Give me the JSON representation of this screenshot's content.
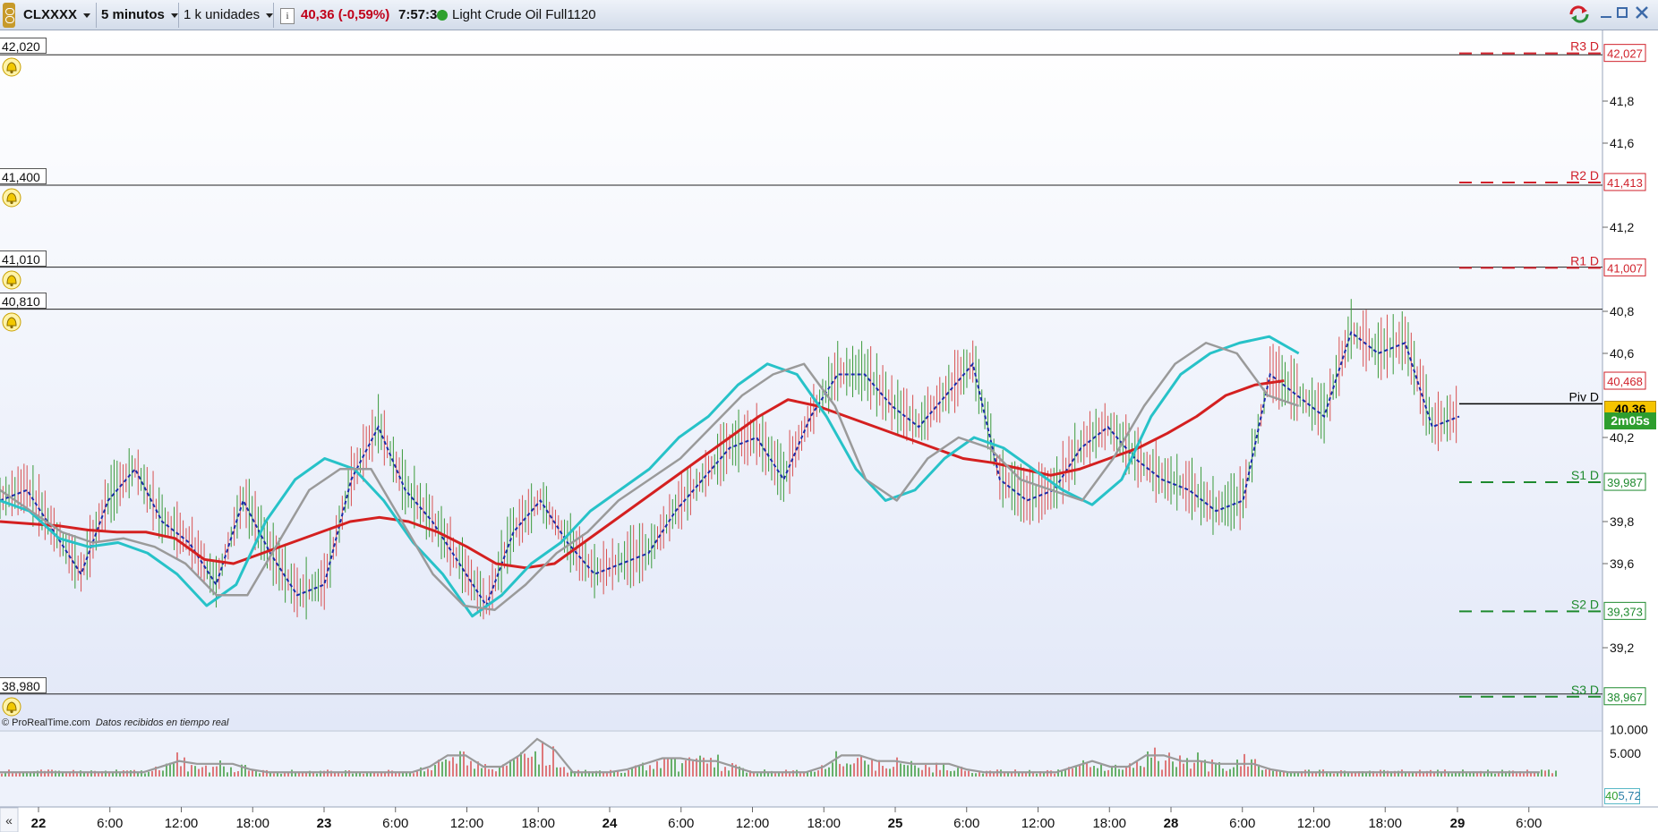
{
  "toolbar": {
    "symbol": "CLXXXX",
    "timeframe": "5 minutos",
    "units": "1 k unidades",
    "price_change": "40,36 (-0,59%)",
    "time": "7:57:34",
    "instrument": "Light Crude Oil Full1120",
    "colors": {
      "change": "#c0001a",
      "status_dot": "#2ea12e"
    }
  },
  "window_controls": [
    "refresh-icon",
    "minimize-icon",
    "maximize-icon",
    "close-icon"
  ],
  "horizontal_lines": [
    {
      "price": 42.02,
      "label": "42,020"
    },
    {
      "price": 41.4,
      "label": "41,400"
    },
    {
      "price": 41.01,
      "label": "41,010"
    },
    {
      "price": 40.81,
      "label": "40,810"
    },
    {
      "price": 38.98,
      "label": "38,980"
    }
  ],
  "pivots": [
    {
      "name": "R3 D",
      "value": 42.027,
      "label": "42,027",
      "color": "#d0202a"
    },
    {
      "name": "R2 D",
      "value": 41.413,
      "label": "41,413",
      "color": "#d0202a"
    },
    {
      "name": "R1 D",
      "value": 41.007,
      "label": "41,007",
      "color": "#d0202a"
    },
    {
      "name": "Piv D",
      "value": 40.36,
      "label": "",
      "color": "#000000"
    },
    {
      "name": "S1 D",
      "value": 39.987,
      "label": "39,987",
      "color": "#1e8a2e"
    },
    {
      "name": "S2 D",
      "value": 39.373,
      "label": "39,373",
      "color": "#1e8a2e"
    },
    {
      "name": "S3 D",
      "value": 38.967,
      "label": "38,967",
      "color": "#1e8a2e"
    }
  ],
  "price_axis": {
    "ticks": [
      {
        "v": 41.8,
        "l": "41,8"
      },
      {
        "v": 41.6,
        "l": "41,6"
      },
      {
        "v": 41.2,
        "l": "41,2"
      },
      {
        "v": 40.8,
        "l": "40,8"
      },
      {
        "v": 40.6,
        "l": "40,6"
      },
      {
        "v": 40.2,
        "l": "40,2"
      },
      {
        "v": 39.8,
        "l": "39,8"
      },
      {
        "v": 39.6,
        "l": "39,6"
      },
      {
        "v": 39.2,
        "l": "39,2"
      }
    ],
    "ma_value": {
      "v": 40.468,
      "l": "40,468"
    },
    "last_price": {
      "v": 40.36,
      "l": "40,36"
    },
    "countdown": "2m05s"
  },
  "volume_axis": {
    "ticks": [
      {
        "v": 10000,
        "l": "10.000"
      },
      {
        "v": 5000,
        "l": "5.000"
      }
    ],
    "current": "40",
    "current_suffix": "5,72"
  },
  "footer_note": {
    "site": "© ProRealTime.com",
    "status": "Datos recibidos en tiempo real"
  },
  "time_axis": [
    {
      "l": "22",
      "bold": true
    },
    {
      "l": "6:00"
    },
    {
      "l": "12:00"
    },
    {
      "l": "18:00"
    },
    {
      "l": "23",
      "bold": true
    },
    {
      "l": "6:00"
    },
    {
      "l": "12:00"
    },
    {
      "l": "18:00"
    },
    {
      "l": "24",
      "bold": true
    },
    {
      "l": "6:00"
    },
    {
      "l": "12:00"
    },
    {
      "l": "18:00"
    },
    {
      "l": "25",
      "bold": true
    },
    {
      "l": "6:00"
    },
    {
      "l": "12:00"
    },
    {
      "l": "18:00"
    },
    {
      "l": "28",
      "bold": true
    },
    {
      "l": "6:00"
    },
    {
      "l": "12:00"
    },
    {
      "l": "18:00"
    },
    {
      "l": "29",
      "bold": true
    },
    {
      "l": "6:00"
    }
  ],
  "chart_data": {
    "type": "line",
    "x": [
      0,
      10,
      20,
      30,
      40,
      50,
      60,
      70,
      80,
      90,
      100,
      110,
      120,
      130,
      140,
      150,
      160,
      170,
      180,
      190,
      200,
      210,
      220,
      230,
      240,
      250,
      260,
      270,
      280,
      290,
      300,
      310,
      320,
      330,
      340,
      350,
      360,
      370,
      380,
      390,
      400,
      410,
      420,
      430,
      440,
      450,
      460,
      470,
      480,
      490,
      500,
      510,
      520,
      530,
      540
    ],
    "series": [
      {
        "name": "",
        "color": "#1a7f1a",
        "values": [
          39.9,
          39.95,
          39.75,
          39.55,
          39.9,
          40.05,
          39.8,
          39.7,
          39.5,
          39.9,
          39.65,
          39.45,
          39.5,
          40.0,
          40.25,
          39.95,
          39.8,
          39.6,
          39.4,
          39.75,
          39.9,
          39.7,
          39.55,
          39.6,
          39.65,
          39.85,
          40.0,
          40.15,
          40.2,
          40.0,
          40.3,
          40.5,
          40.5,
          40.35,
          40.25,
          40.4,
          40.55,
          40.0,
          39.9,
          39.95,
          40.15,
          40.25,
          40.1,
          40.0,
          39.95,
          39.85,
          39.9,
          40.5,
          40.4,
          40.3,
          40.7,
          40.6,
          40.65,
          40.25,
          40.3
        ]
      },
      {
        "name": "",
        "color": "#d42020",
        "values": [
          39.8,
          39.79,
          39.78,
          39.76,
          39.75,
          39.75,
          39.72,
          39.62,
          39.6,
          39.65,
          39.7,
          39.75,
          39.8,
          39.82,
          39.8,
          39.75,
          39.68,
          39.6,
          39.58,
          39.6,
          39.7,
          39.8,
          39.9,
          40.0,
          40.1,
          40.2,
          40.3,
          40.38,
          40.35,
          40.3,
          40.25,
          40.2,
          40.15,
          40.1,
          40.08,
          40.05,
          40.02,
          40.05,
          40.1,
          40.15,
          40.22,
          40.3,
          40.4,
          40.45,
          40.47
        ]
      },
      {
        "name": "",
        "color": "#27c2c8",
        "values": [
          39.9,
          39.85,
          39.72,
          39.68,
          39.7,
          39.65,
          39.55,
          39.4,
          39.5,
          39.8,
          40.0,
          40.1,
          40.05,
          39.9,
          39.7,
          39.55,
          39.35,
          39.45,
          39.6,
          39.7,
          39.85,
          39.95,
          40.05,
          40.2,
          40.3,
          40.45,
          40.55,
          40.5,
          40.3,
          40.05,
          39.9,
          39.95,
          40.1,
          40.2,
          40.15,
          40.05,
          39.95,
          39.88,
          40.0,
          40.3,
          40.5,
          40.6,
          40.65,
          40.68,
          40.6
        ]
      },
      {
        "name": "",
        "color": "#9a9a9a",
        "values": [
          39.95,
          39.85,
          39.75,
          39.7,
          39.72,
          39.68,
          39.6,
          39.45,
          39.45,
          39.7,
          39.95,
          40.05,
          40.05,
          39.8,
          39.55,
          39.4,
          39.38,
          39.5,
          39.65,
          39.75,
          39.9,
          40.0,
          40.1,
          40.25,
          40.4,
          40.5,
          40.55,
          40.35,
          40.0,
          39.9,
          40.1,
          40.2,
          40.15,
          40.0,
          39.95,
          39.9,
          40.1,
          40.35,
          40.55,
          40.65,
          40.6,
          40.4,
          40.35
        ]
      }
    ],
    "ylim": [
      38.85,
      42.1
    ],
    "volume_ylim": [
      0,
      12000
    ]
  }
}
